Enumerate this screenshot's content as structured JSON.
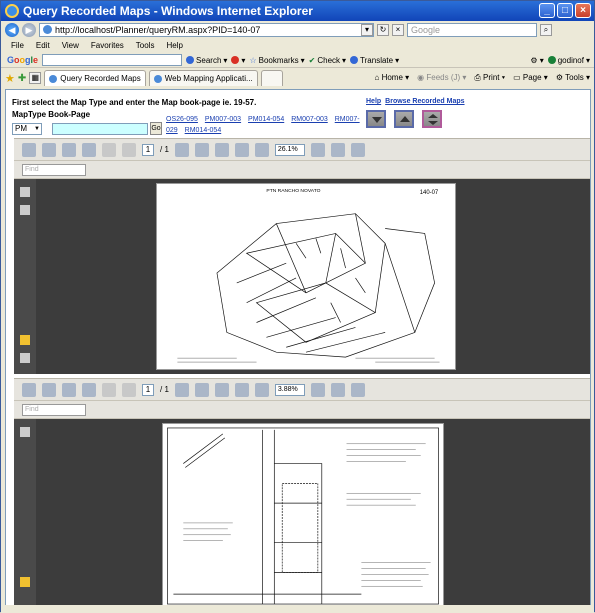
{
  "window": {
    "title": "Query Recorded Maps - Windows Internet Explorer"
  },
  "address": {
    "url": "http://localhost/Planner/queryRM.aspx?PID=140-07",
    "search_placeholder": "Google"
  },
  "menu": [
    "File",
    "Edit",
    "View",
    "Favorites",
    "Tools",
    "Help"
  ],
  "google_toolbar": {
    "logo": "Google",
    "search_label": "Search",
    "bookmarks_label": "Bookmarks",
    "check_label": "Check",
    "translate_label": "Translate",
    "user_label": "godinof"
  },
  "tabs": [
    {
      "label": "Query Recorded Maps",
      "active": true
    },
    {
      "label": "Web Mapping Applicati...",
      "active": false
    }
  ],
  "tab_tools": {
    "home": "Home",
    "feeds": "Feeds (J)",
    "print": "Print",
    "page": "Page",
    "tools": "Tools"
  },
  "page": {
    "instruction": "First select the Map Type and enter the Map book-page ie. 19-57.",
    "maptype_label": "MapType Book-Page",
    "maptype_value": "PM",
    "book_page_value": "",
    "go_label": "Go",
    "help_link": "Help",
    "browse_link": "Browse Recorded Maps",
    "map_links": [
      "OS26-095",
      "PM007-003",
      "PM014-054",
      "RM007-003",
      "RM007-029",
      "RM014-054"
    ]
  },
  "viewer1": {
    "page": "1",
    "page_total": "/ 1",
    "zoom": "26.1%",
    "find_placeholder": "Find"
  },
  "viewer2": {
    "page": "1",
    "page_total": "/ 1",
    "zoom": "3.88%",
    "find_placeholder": "Find"
  },
  "map1": {
    "title": "PTN RANCHO NOVATO",
    "sheet": "140-07"
  }
}
